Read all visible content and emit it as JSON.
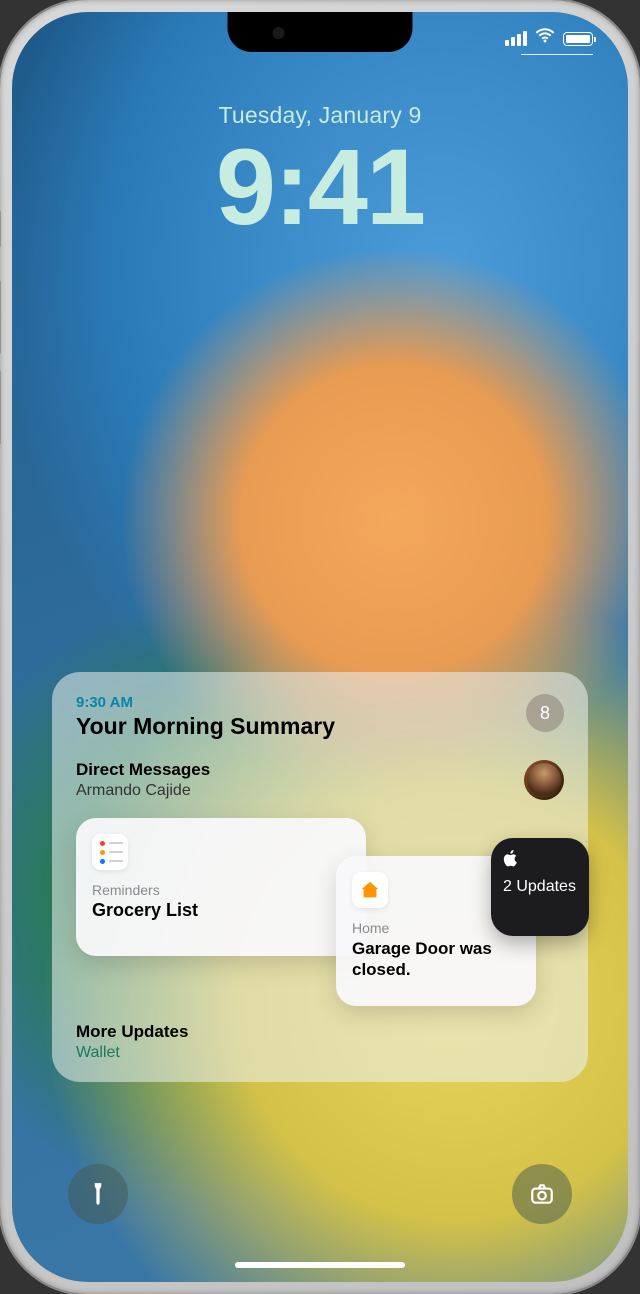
{
  "lockscreen": {
    "date": "Tuesday, January 9",
    "time": "9:41"
  },
  "summary": {
    "time": "9:30 AM",
    "title": "Your Morning Summary",
    "count": "8",
    "direct_messages": {
      "heading": "Direct Messages",
      "sender": "Armando Cajide"
    },
    "cards": {
      "reminders": {
        "app": "Reminders",
        "title": "Grocery List"
      },
      "home": {
        "app": "Home",
        "body": "Garage Door was closed."
      },
      "updates": {
        "count_label": "2 Updates"
      }
    },
    "more": {
      "heading": "More Updates",
      "app": "Wallet"
    }
  }
}
